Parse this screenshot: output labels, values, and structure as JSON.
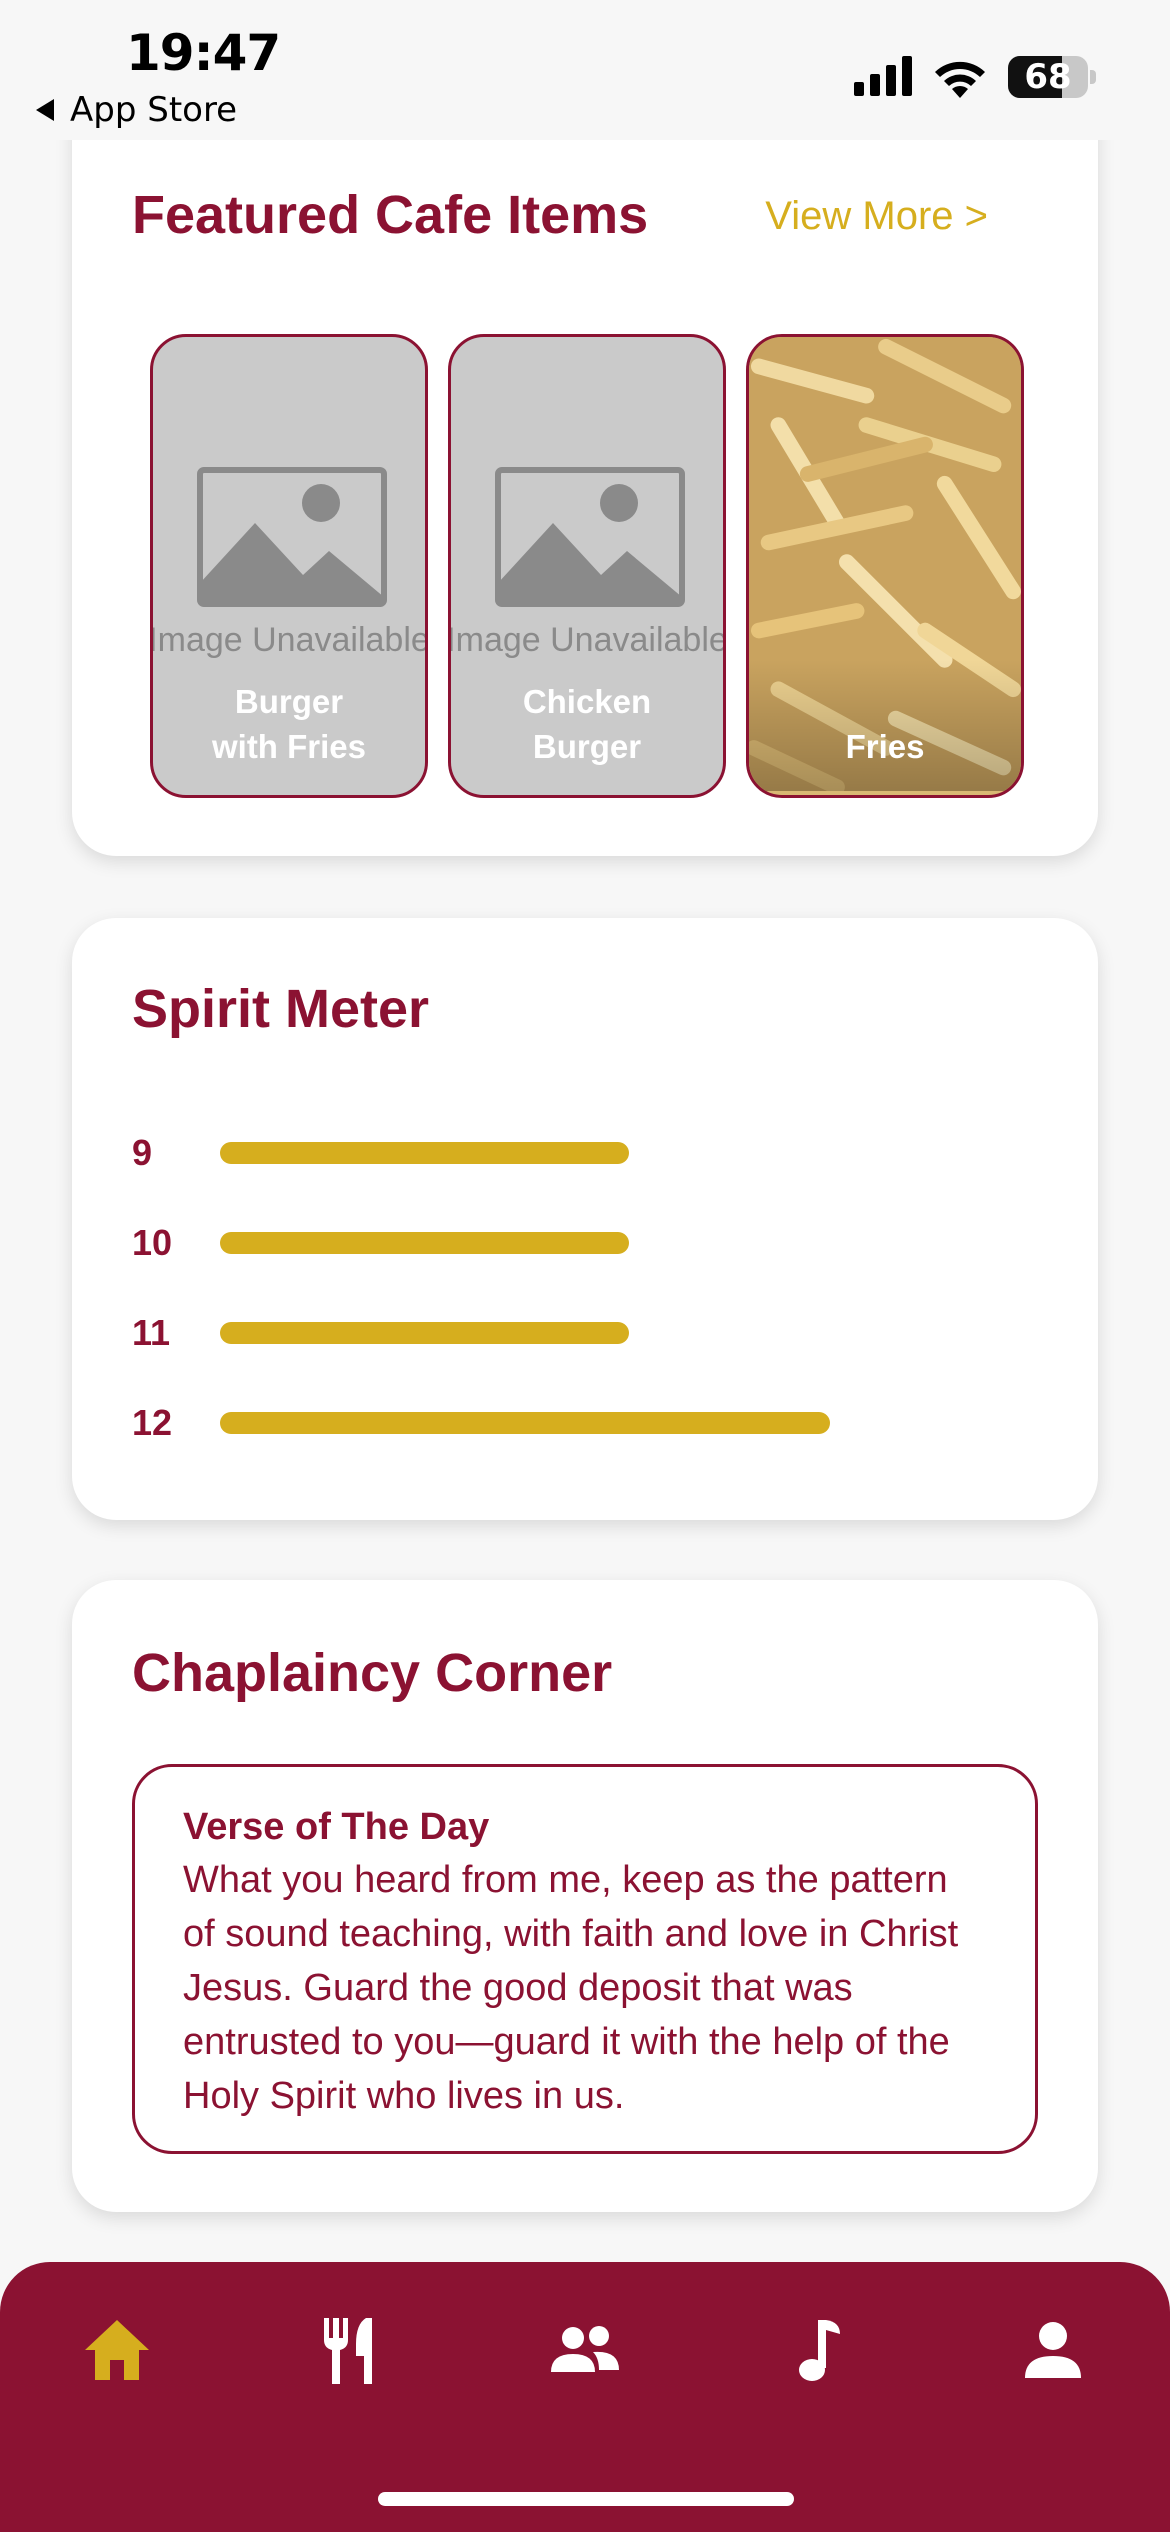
{
  "status_bar": {
    "time": "19:47",
    "back_label": "App Store",
    "battery": "68",
    "battery_level": 0.68
  },
  "featured": {
    "title": "Featured Cafe Items",
    "view_more": "View More >",
    "items": [
      {
        "placeholder": "Image Unavailable",
        "name_line1": "Burger",
        "name_line2": "with Fries"
      },
      {
        "placeholder": "Image Unavailable",
        "name_line1": "Chicken",
        "name_line2": "Burger"
      },
      {
        "name": "Fries"
      }
    ]
  },
  "spirit_meter": {
    "title": "Spirit Meter",
    "rows": [
      {
        "label": "9",
        "value": 0.67
      },
      {
        "label": "10",
        "value": 0.67
      },
      {
        "label": "11",
        "value": 0.67
      },
      {
        "label": "12",
        "value": 1.0
      }
    ]
  },
  "chaplaincy": {
    "title": "Chaplaincy Corner",
    "verse_title": "Verse of The Day",
    "verse_text": "What you heard from me, keep as the pattern of sound teaching, with faith and love in Christ Jesus. Guard the good deposit that was entrusted to you—guard it with the help of the Holy Spirit who lives in us."
  },
  "nav": {
    "items": [
      "home-icon",
      "dining-icon",
      "people-icon",
      "music-icon",
      "profile-icon"
    ],
    "active": "home-icon"
  },
  "colors": {
    "brand": "#8b1232",
    "accent": "#d6ae1e"
  }
}
